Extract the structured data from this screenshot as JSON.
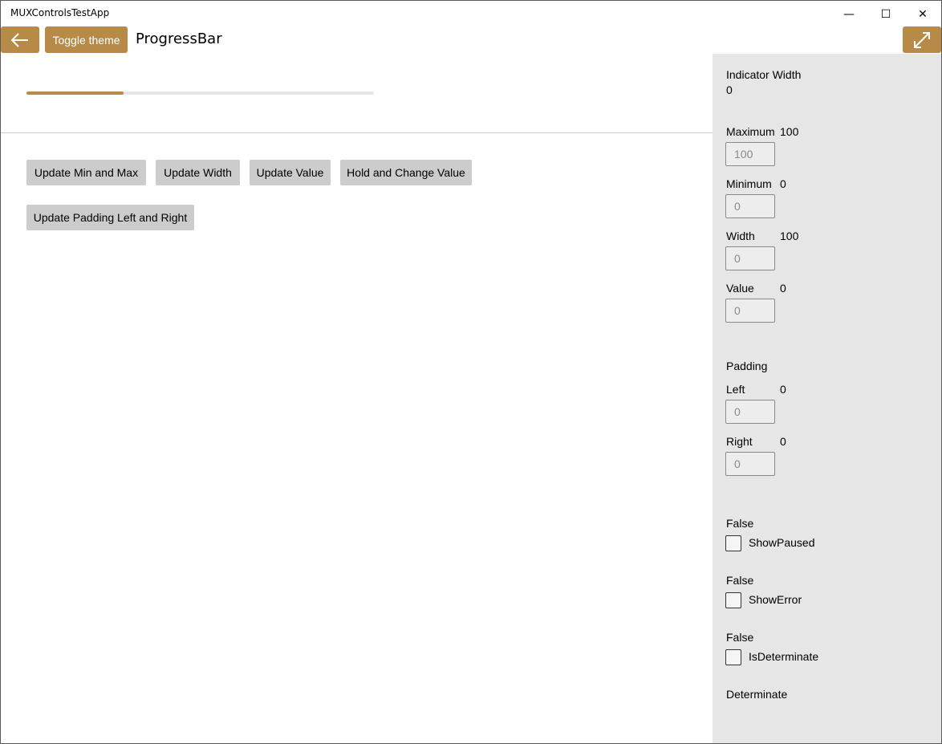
{
  "window": {
    "title": "MUXControlsTestApp",
    "minimize_glyph": "—",
    "maximize_glyph": "☐",
    "close_glyph": "✕"
  },
  "header": {
    "back_icon": "arrow-left-icon",
    "toggle_theme_label": "Toggle theme",
    "page_title": "ProgressBar",
    "fullscreen_icon": "expand-icon",
    "accent_color": "#b88a48"
  },
  "progress": {
    "value_fraction": 0.28
  },
  "buttons": {
    "update_min_max": "Update Min and Max",
    "update_width": "Update Width",
    "update_value": "Update Value",
    "hold_change_value": "Hold and Change Value",
    "update_padding": "Update Padding Left and Right"
  },
  "panel": {
    "indicator_width_label": "Indicator Width",
    "indicator_width_value": "0",
    "maximum_label": "Maximum",
    "maximum_value": "100",
    "maximum_placeholder": "100",
    "minimum_label": "Minimum",
    "minimum_value": "0",
    "minimum_placeholder": "0",
    "width_label": "Width",
    "width_value": "100",
    "width_placeholder": "0",
    "value_label": "Value",
    "value_value": "0",
    "value_placeholder": "0",
    "padding_label": "Padding",
    "left_label": "Left",
    "left_value": "0",
    "left_placeholder": "0",
    "right_label": "Right",
    "right_value": "0",
    "right_placeholder": "0",
    "show_paused_state": "False",
    "show_paused_label": "ShowPaused",
    "show_error_state": "False",
    "show_error_label": "ShowError",
    "is_determinate_state": "False",
    "is_determinate_label": "IsDeterminate",
    "visual_state": "Determinate"
  }
}
